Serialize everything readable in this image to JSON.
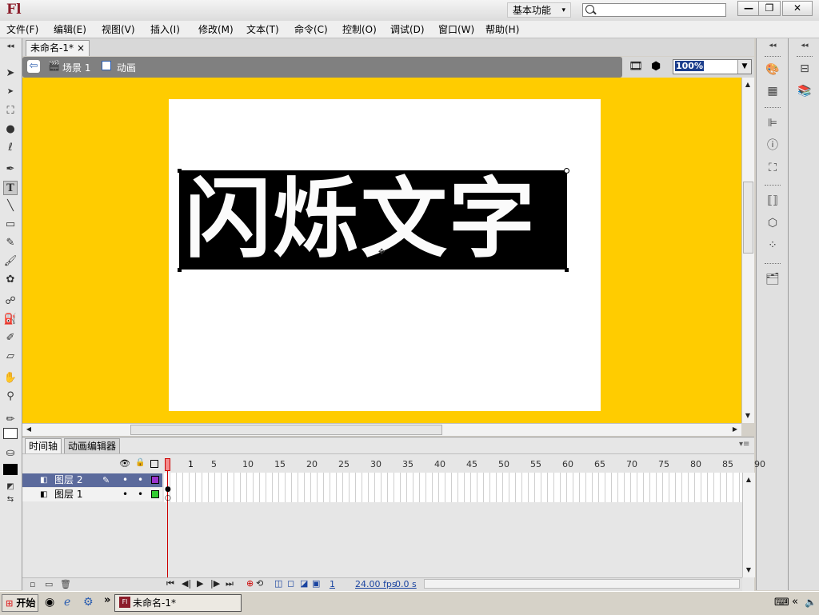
{
  "app": {
    "logo": "Fl",
    "workspace": "基本功能",
    "window_buttons": [
      "—",
      "❐",
      "✕"
    ]
  },
  "menu": [
    "文件(F)",
    "编辑(E)",
    "视图(V)",
    "插入(I)",
    "修改(M)",
    "文本(T)",
    "命令(C)",
    "控制(O)",
    "调试(D)",
    "窗口(W)",
    "帮助(H)"
  ],
  "document_tab": {
    "title": "未命名-1*",
    "close": "×"
  },
  "edit_bar": {
    "scene": "场景 1",
    "symbol": "动画",
    "zoom": "100%"
  },
  "stage": {
    "text": "闪烁文字",
    "pasteboard_color": "#ffcc00"
  },
  "timeline": {
    "tabs": [
      "时间轴",
      "动画编辑器"
    ],
    "frame_numbers": [
      "1",
      "5",
      "10",
      "15",
      "20",
      "25",
      "30",
      "35",
      "40",
      "45",
      "50",
      "55",
      "60",
      "65",
      "70",
      "75",
      "80",
      "85",
      "90"
    ],
    "layers": [
      {
        "name": "图层 2",
        "color": "#9933cc"
      },
      {
        "name": "图层 1",
        "color": "#33cc33"
      }
    ],
    "status": {
      "frame": "1",
      "fps": "24.00 fps",
      "time": "0.0 s"
    }
  },
  "taskbar": {
    "start": "开始",
    "task": "未命名-1*",
    "chevron": "»"
  },
  "icons": [
    "selection-tool-icon",
    "subselection-tool-icon",
    "free-transform-icon",
    "3d-rotation-icon",
    "lasso-icon",
    "pen-icon",
    "text-tool-icon",
    "line-icon",
    "rectangle-icon",
    "pencil-icon",
    "brush-icon",
    "deco-icon",
    "bone-icon",
    "paint-bucket-icon",
    "eyedropper-icon",
    "eraser-icon",
    "hand-icon",
    "zoom-icon"
  ]
}
